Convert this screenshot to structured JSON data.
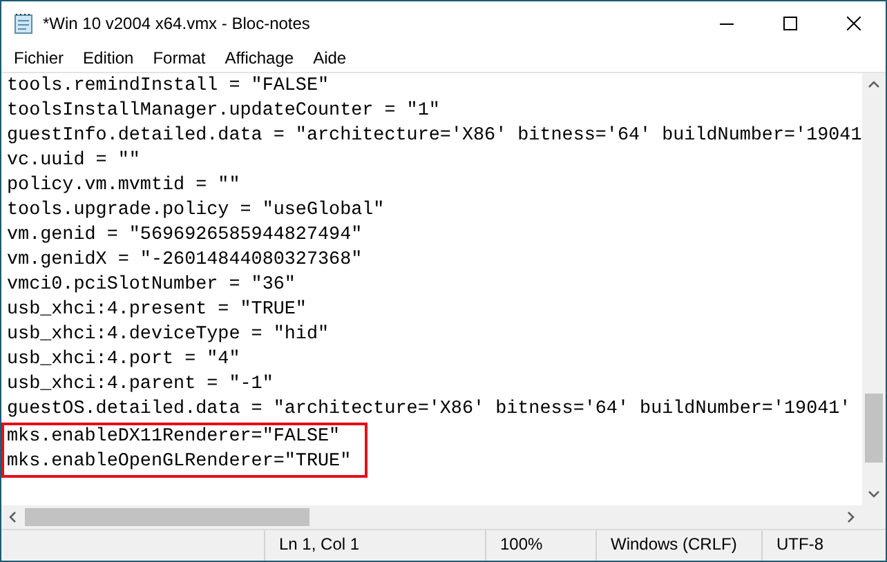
{
  "window": {
    "title": "*Win 10 v2004 x64.vmx - Bloc-notes"
  },
  "menu": [
    "Fichier",
    "Edition",
    "Format",
    "Affichage",
    "Aide"
  ],
  "editor": {
    "lines": [
      {
        "text": "tools.remindInstall = \"FALSE\"",
        "highlighted": false
      },
      {
        "text": "toolsInstallManager.updateCounter = \"1\"",
        "highlighted": false
      },
      {
        "text": "guestInfo.detailed.data = \"architecture='X86' bitness='64' buildNumber='19041",
        "highlighted": false
      },
      {
        "text": "vc.uuid = \"\"",
        "highlighted": false
      },
      {
        "text": "policy.vm.mvmtid = \"\"",
        "highlighted": false
      },
      {
        "text": "tools.upgrade.policy = \"useGlobal\"",
        "highlighted": false
      },
      {
        "text": "vm.genid = \"5696926585944827494\"",
        "highlighted": false
      },
      {
        "text": "vm.genidX = \"-26014844080327368\"",
        "highlighted": false
      },
      {
        "text": "vmci0.pciSlotNumber = \"36\"",
        "highlighted": false
      },
      {
        "text": "usb_xhci:4.present = \"TRUE\"",
        "highlighted": false
      },
      {
        "text": "usb_xhci:4.deviceType = \"hid\"",
        "highlighted": false
      },
      {
        "text": "usb_xhci:4.port = \"4\"",
        "highlighted": false
      },
      {
        "text": "usb_xhci:4.parent = \"-1\"",
        "highlighted": false
      },
      {
        "text": "guestOS.detailed.data = \"architecture='X86' bitness='64' buildNumber='19041'",
        "highlighted": false
      },
      {
        "text": "mks.enableDX11Renderer=\"FALSE\"",
        "highlighted": true
      },
      {
        "text": "mks.enableOpenGLRenderer=\"TRUE\"",
        "highlighted": true
      }
    ]
  },
  "status_bar": [
    "Ln 1, Col 1",
    "100%",
    "Windows (CRLF)",
    "UTF-8"
  ]
}
